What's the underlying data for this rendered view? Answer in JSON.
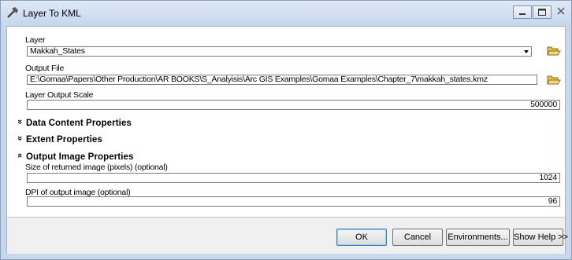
{
  "window": {
    "title": "Layer To KML"
  },
  "fields": {
    "layer": {
      "label": "Layer",
      "value": "Makkah_States"
    },
    "output_file": {
      "label": "Output File",
      "value": "E:\\Gomaa\\Papers\\Other Production\\AR BOOKS\\S_Analyisis\\Arc GIS Examples\\Gomaa Examples\\Chapter_7\\makkah_states.kmz"
    },
    "scale": {
      "label": "Layer Output Scale",
      "value": "500000"
    }
  },
  "sections": {
    "data_content": {
      "chevron": "»",
      "label": "Data Content Properties",
      "expanded": false
    },
    "extent": {
      "chevron": "»",
      "label": "Extent Properties",
      "expanded": false
    },
    "output_image": {
      "chevron": "«",
      "label": "Output Image Properties",
      "expanded": true
    }
  },
  "image_fields": {
    "size": {
      "label": "Size of returned image (pixels) (optional)",
      "value": "1024"
    },
    "dpi": {
      "label": "DPI of output image (optional)",
      "value": "96"
    }
  },
  "buttons": {
    "ok": "OK",
    "cancel": "Cancel",
    "environments": "Environments...",
    "show_help": "Show Help >>"
  },
  "icons": {
    "app": "hammer-icon",
    "browse": "open-folder-icon",
    "dropdown": "chevron-down-icon"
  },
  "colors": {
    "title_bar": "#c6d6eb",
    "panel": "#ffffff",
    "button_bar": "#f0f0f0",
    "folder": "#e8c04a"
  }
}
